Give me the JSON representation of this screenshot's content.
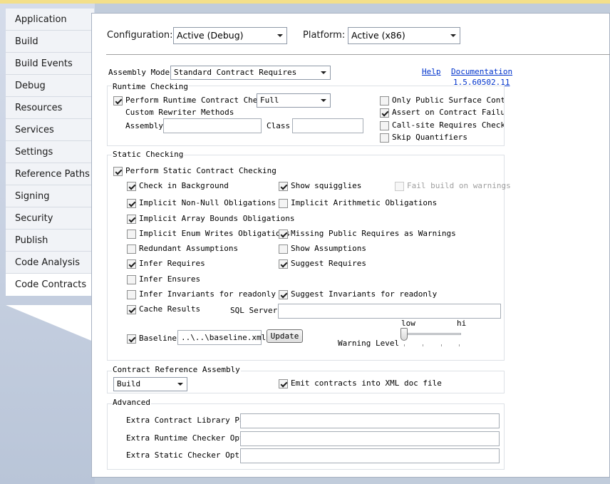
{
  "sidebar": {
    "tabs": [
      "Application",
      "Build",
      "Build Events",
      "Debug",
      "Resources",
      "Services",
      "Settings",
      "Reference Paths",
      "Signing",
      "Security",
      "Publish",
      "Code Analysis",
      "Code Contracts"
    ],
    "selected": "Code Contracts"
  },
  "header": {
    "configuration_label": "Configuration:",
    "configuration_value": "Active (Debug)",
    "platform_label": "Platform:",
    "platform_value": "Active (x86)"
  },
  "assembly_mode": {
    "label": "Assembly Mode:",
    "value": "Standard Contract Requires",
    "help_link": "Help",
    "documentation_link": "Documentation",
    "version_link": "1.5.60502.11"
  },
  "runtime_checking": {
    "title": "Runtime Checking",
    "perform_label": "Perform Runtime Contract Checking",
    "perform_checked": true,
    "level_value": "Full",
    "custom_rewriter_label": "Custom Rewriter Methods",
    "assembly_label": "Assembly",
    "assembly_value": "",
    "class_label": "Class",
    "class_value": "",
    "only_public_label": "Only Public Surface Contracts",
    "only_public_checked": false,
    "assert_on_failure_label": "Assert on Contract Failure",
    "assert_on_failure_checked": true,
    "call_site_label": "Call-site Requires Checking",
    "call_site_checked": false,
    "skip_quantifiers_label": "Skip Quantifiers",
    "skip_quantifiers_checked": false
  },
  "static_checking": {
    "title": "Static Checking",
    "perform_label": "Perform Static Contract Checking",
    "perform_checked": true,
    "check_in_background": {
      "label": "Check in Background",
      "checked": true
    },
    "show_squiggles": {
      "label": "Show squigglies",
      "checked": true
    },
    "fail_build": {
      "label": "Fail build on warnings",
      "checked": false
    },
    "implicit_non_null": {
      "label": "Implicit Non-Null Obligations",
      "checked": true
    },
    "implicit_arithmetic": {
      "label": "Implicit Arithmetic Obligations",
      "checked": false
    },
    "implicit_array_bounds": {
      "label": "Implicit Array Bounds Obligations",
      "checked": true
    },
    "implicit_enum_writes": {
      "label": "Implicit Enum Writes Obligations",
      "checked": false
    },
    "missing_public_requires": {
      "label": "Missing Public Requires as Warnings",
      "checked": true
    },
    "redundant_assumptions": {
      "label": "Redundant Assumptions",
      "checked": false
    },
    "show_assumptions": {
      "label": "Show Assumptions",
      "checked": false
    },
    "infer_requires": {
      "label": "Infer Requires",
      "checked": true
    },
    "suggest_requires": {
      "label": "Suggest Requires",
      "checked": true
    },
    "infer_ensures": {
      "label": "Infer Ensures",
      "checked": false
    },
    "infer_invariants_readonly": {
      "label": "Infer Invariants for readonly",
      "checked": false
    },
    "suggest_invariants_readonly": {
      "label": "Suggest Invariants for readonly",
      "checked": true
    },
    "cache_results": {
      "label": "Cache Results",
      "checked": true
    },
    "sql_server_label": "SQL Server",
    "sql_server_value": "",
    "baseline": {
      "label": "Baseline",
      "checked": true,
      "value": "..\\..\\baseline.xml"
    },
    "update_button": "Update",
    "warning_level_label": "Warning Level",
    "slider_low_label": "low",
    "slider_high_label": "hi",
    "warning_level_fraction": 0.0
  },
  "contract_reference": {
    "title": "Contract Reference Assembly",
    "value": "Build",
    "emit_xml_label": "Emit contracts into XML doc file",
    "emit_xml_checked": true
  },
  "advanced": {
    "title": "Advanced",
    "extra_library_paths_label": "Extra Contract Library Paths",
    "extra_library_paths_value": "",
    "extra_runtime_options_label": "Extra Runtime Checker Options",
    "extra_runtime_options_value": "",
    "extra_static_options_label": "Extra Static Checker Options",
    "extra_static_options_value": ""
  }
}
